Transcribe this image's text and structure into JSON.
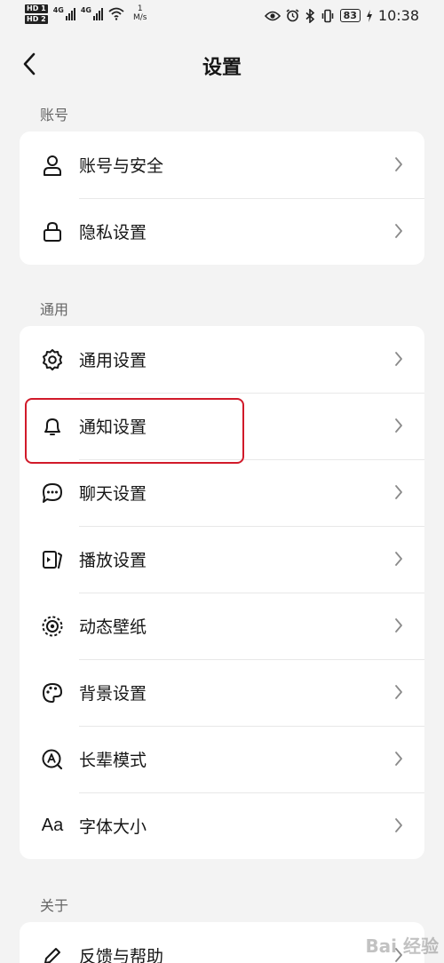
{
  "status_bar": {
    "hd1": "HD 1",
    "hd2": "HD 2",
    "net1": "4G",
    "net2": "4G",
    "speed_value": "1",
    "speed_unit": "M/s",
    "battery": "83",
    "time": "10:38"
  },
  "header": {
    "title": "设置"
  },
  "sections": {
    "account": {
      "label": "账号",
      "items": [
        {
          "label": "账号与安全",
          "icon": "person-icon"
        },
        {
          "label": "隐私设置",
          "icon": "lock-icon"
        }
      ]
    },
    "general": {
      "label": "通用",
      "items": [
        {
          "label": "通用设置",
          "icon": "gear-icon"
        },
        {
          "label": "通知设置",
          "icon": "bell-icon"
        },
        {
          "label": "聊天设置",
          "icon": "chat-bubble-icon"
        },
        {
          "label": "播放设置",
          "icon": "play-settings-icon"
        },
        {
          "label": "动态壁纸",
          "icon": "live-wallpaper-icon"
        },
        {
          "label": "背景设置",
          "icon": "palette-icon"
        },
        {
          "label": "长辈模式",
          "icon": "elder-mode-icon"
        },
        {
          "label": "字体大小",
          "icon_text": "Aa",
          "icon": "font-size-icon"
        }
      ]
    },
    "about": {
      "label": "关于",
      "items": [
        {
          "label": "反馈与帮助",
          "icon": "pencil-icon"
        }
      ]
    }
  },
  "watermark": "Bai 经验",
  "colors": {
    "highlight": "#d11a2a",
    "background": "#f3f3f3",
    "card": "#ffffff"
  }
}
